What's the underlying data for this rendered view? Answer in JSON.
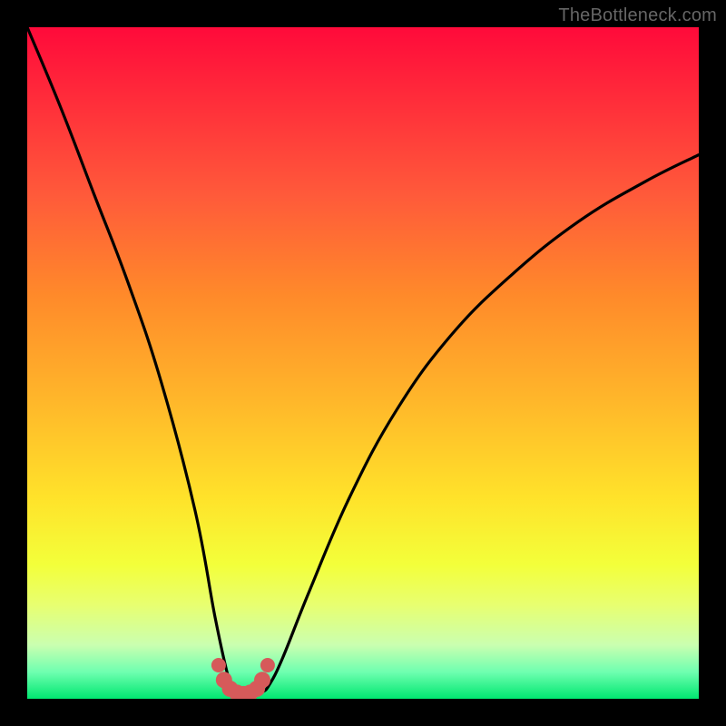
{
  "watermark": "TheBottleneck.com",
  "chart_data": {
    "type": "line",
    "title": "",
    "xlabel": "",
    "ylabel": "",
    "xlim": [
      0,
      100
    ],
    "ylim": [
      0,
      100
    ],
    "series": [
      {
        "name": "bottleneck-curve",
        "x": [
          0,
          5,
          10,
          15,
          20,
          25,
          28,
          30,
          31,
          32,
          33,
          34,
          35,
          36,
          38,
          42,
          48,
          55,
          63,
          72,
          82,
          92,
          100
        ],
        "y": [
          100,
          88,
          75,
          62,
          47,
          28,
          12,
          3,
          1,
          0.5,
          0.5,
          0.5,
          1,
          2,
          6,
          16,
          30,
          43,
          54,
          63,
          71,
          77,
          81
        ]
      }
    ],
    "markers": {
      "name": "trough-dots",
      "color": "#d65a5a",
      "x": [
        28.5,
        29.3,
        30.2,
        31.2,
        32.2,
        33.2,
        34.2,
        35.0,
        35.8
      ],
      "y": [
        5.0,
        2.8,
        1.5,
        0.9,
        0.7,
        0.9,
        1.5,
        2.8,
        5.0
      ]
    },
    "gradient_stops": [
      {
        "pos": 0.0,
        "color": "#ff0a3a"
      },
      {
        "pos": 0.25,
        "color": "#ff5a3a"
      },
      {
        "pos": 0.55,
        "color": "#ffb52a"
      },
      {
        "pos": 0.8,
        "color": "#f3ff3a"
      },
      {
        "pos": 1.0,
        "color": "#00e770"
      }
    ]
  }
}
